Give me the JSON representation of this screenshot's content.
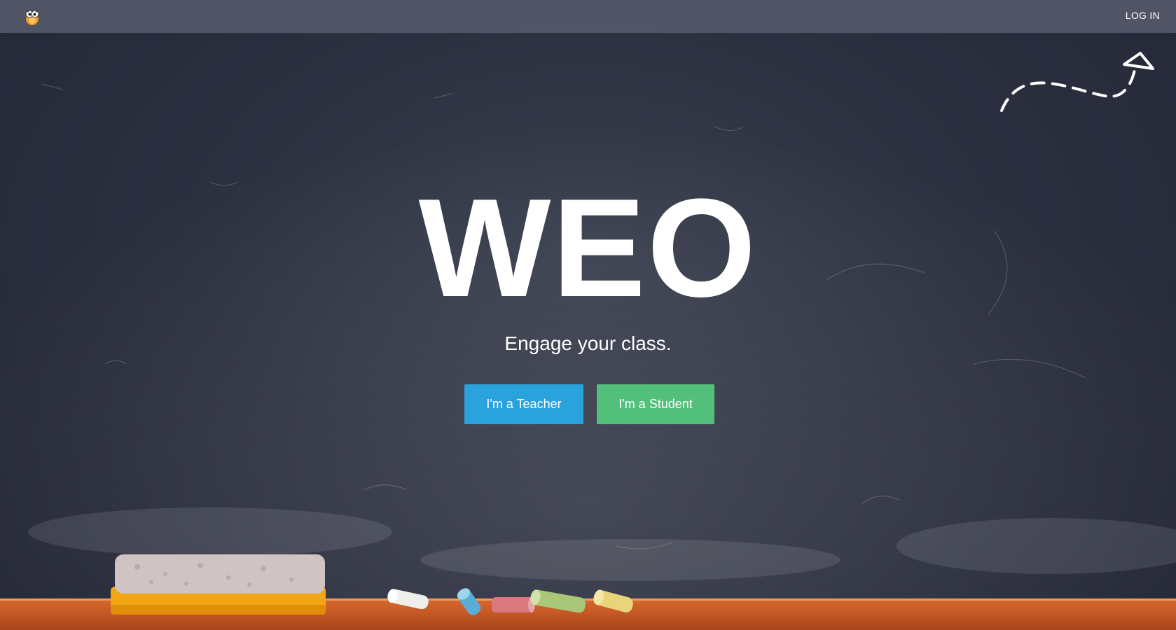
{
  "header": {
    "logo_icon": "owl-logo-icon",
    "login_label": "LOG IN"
  },
  "hero": {
    "title": "WEO",
    "tagline": "Engage your class."
  },
  "actions": {
    "teacher_label": "I'm a Teacher",
    "student_label": "I'm a Student"
  },
  "colors": {
    "teacher_button": "#2aa3dd",
    "student_button": "#52bf7b",
    "chalkboard": "#2c3040",
    "topbar": "#555868",
    "ledge": "#c85a26"
  },
  "decor": {
    "doodle_icon": "dashed-arrow-doodle-icon",
    "eraser_icon": "chalkboard-eraser-icon",
    "chalk_icons": [
      "white-chalk-icon",
      "blue-chalk-icon",
      "pink-chalk-icon",
      "green-chalk-icon",
      "yellow-chalk-icon"
    ]
  }
}
